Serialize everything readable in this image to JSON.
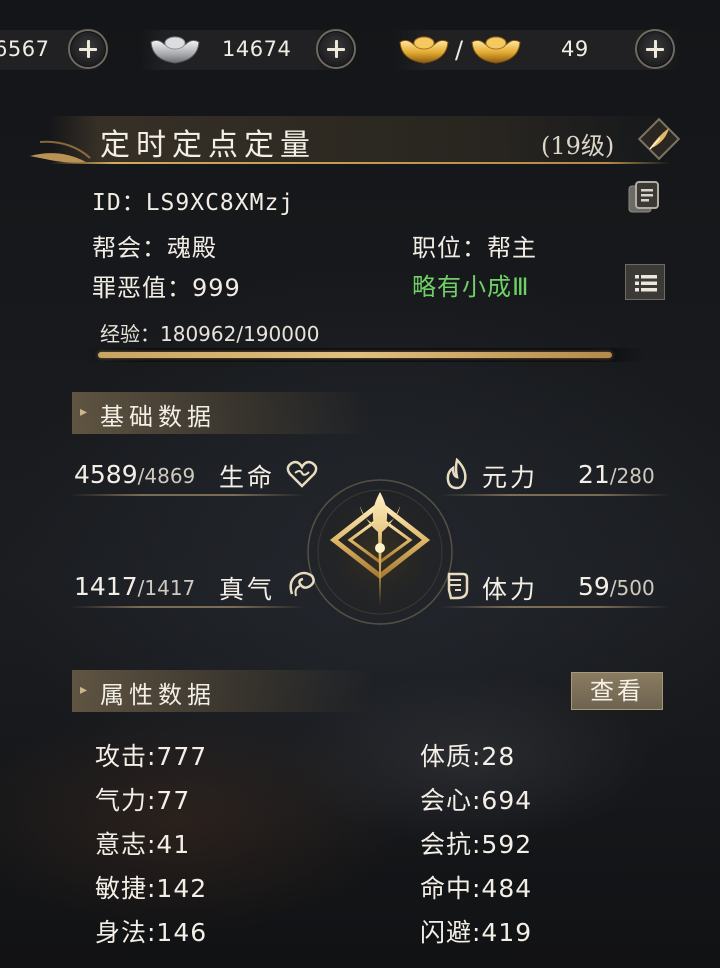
{
  "currency": {
    "coins": "6567",
    "silver": "14674",
    "gold_separator": "/",
    "gold": "49"
  },
  "profile": {
    "name": "定时定点定量",
    "level": "(19级)",
    "id": "ID：LS9XC8XMzj",
    "guild": "帮会：魂殿",
    "position": "职位：帮主",
    "evil_value": "罪恶值：999",
    "rank": "略有小成Ⅲ",
    "exp_text": "经验：180962/190000",
    "exp_progress": 0.952
  },
  "basic_section": {
    "title": "基础数据"
  },
  "basic_stats": {
    "hp_current": "4589",
    "hp_max": "/4869",
    "hp_label": "生命",
    "yuanli_label": "元力",
    "yuanli_current": "21",
    "yuanli_max": "/280",
    "zhenqi_current": "1417",
    "zhenqi_max": "/1417",
    "zhenqi_label": "真气",
    "stamina_label": "体力",
    "stamina_current": "59",
    "stamina_max": "/500"
  },
  "attr_section": {
    "title": "属性数据",
    "view_button": "查看"
  },
  "attributes_left": [
    {
      "text": "攻击:777"
    },
    {
      "text": "气力:77"
    },
    {
      "text": "意志:41"
    },
    {
      "text": "敏捷:142"
    },
    {
      "text": "身法:146"
    }
  ],
  "attributes_right": [
    {
      "text": "体质:28"
    },
    {
      "text": "会心:694"
    },
    {
      "text": "会抗:592"
    },
    {
      "text": "命中:484"
    },
    {
      "text": "闪避:419"
    }
  ],
  "colors": {
    "accent_gold": "#d9b46a",
    "rank_green": "#6fd165",
    "text_main": "#f3efe6"
  },
  "icons": {
    "coin": "coin-icon",
    "silver": "silver-ingot-icon",
    "gold": "gold-ingot-icon",
    "edit": "quill-edit-icon",
    "copy": "copy-icon",
    "list": "list-icon",
    "heart": "heart-icon",
    "flame": "flame-icon",
    "swirl": "swirl-icon",
    "fist": "fist-icon",
    "emblem": "class-emblem-icon"
  }
}
